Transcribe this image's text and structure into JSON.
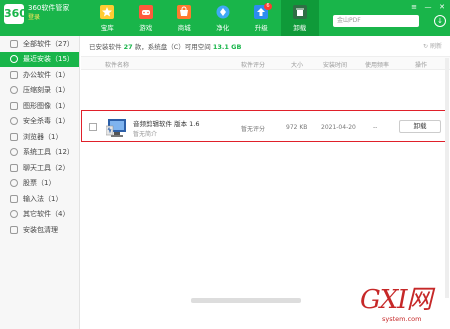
{
  "brand": {
    "logo": "360",
    "title": "360软件管家",
    "login": "登录"
  },
  "tabs": [
    {
      "label": "宝库",
      "icon": "star-icon"
    },
    {
      "label": "游戏",
      "icon": "gamepad-icon"
    },
    {
      "label": "商城",
      "icon": "shop-icon"
    },
    {
      "label": "净化",
      "icon": "purify-icon"
    },
    {
      "label": "升级",
      "icon": "upgrade-icon",
      "badge": "6"
    },
    {
      "label": "卸载",
      "icon": "trash-icon"
    }
  ],
  "search": {
    "placeholder": "金山PDF"
  },
  "window_controls": {
    "menu": "≡",
    "minimize": "—",
    "close": "✕",
    "download": "↓"
  },
  "sidebar": {
    "items": [
      {
        "label": "全部软件（27）"
      },
      {
        "label": "最近安装（15）"
      },
      {
        "label": "办公软件（1）"
      },
      {
        "label": "压缩刻录（1）"
      },
      {
        "label": "图形图像（1）"
      },
      {
        "label": "安全杀毒（1）"
      },
      {
        "label": "浏览器（1）"
      },
      {
        "label": "系统工具（12）"
      },
      {
        "label": "聊天工具（2）"
      },
      {
        "label": "股票（1）"
      },
      {
        "label": "输入法（1）"
      },
      {
        "label": "其它软件（4）"
      },
      {
        "label": "安装包清理"
      }
    ],
    "active_index": 1
  },
  "summary": {
    "prefix": "已安装软件",
    "count": "27",
    "mid": "款，系统盘（C）可用空间",
    "space": "13.1 GB",
    "refresh": "刷新"
  },
  "table": {
    "headers": [
      "软件名称",
      "软件评分",
      "大小",
      "安装时间",
      "使用频率",
      "操作"
    ],
    "rows": [
      {
        "name": "音频剪辑软件 版本 1.6",
        "desc": "暂无简介",
        "rating": "暂无评分",
        "size": "972 KB",
        "date": "2021-04-20",
        "frequency": "--",
        "action": "卸载"
      }
    ]
  },
  "watermark": {
    "big": "GXI网",
    "small": "system.com"
  },
  "colors": {
    "accent": "#19b54a",
    "highlight": "#e0202a"
  }
}
